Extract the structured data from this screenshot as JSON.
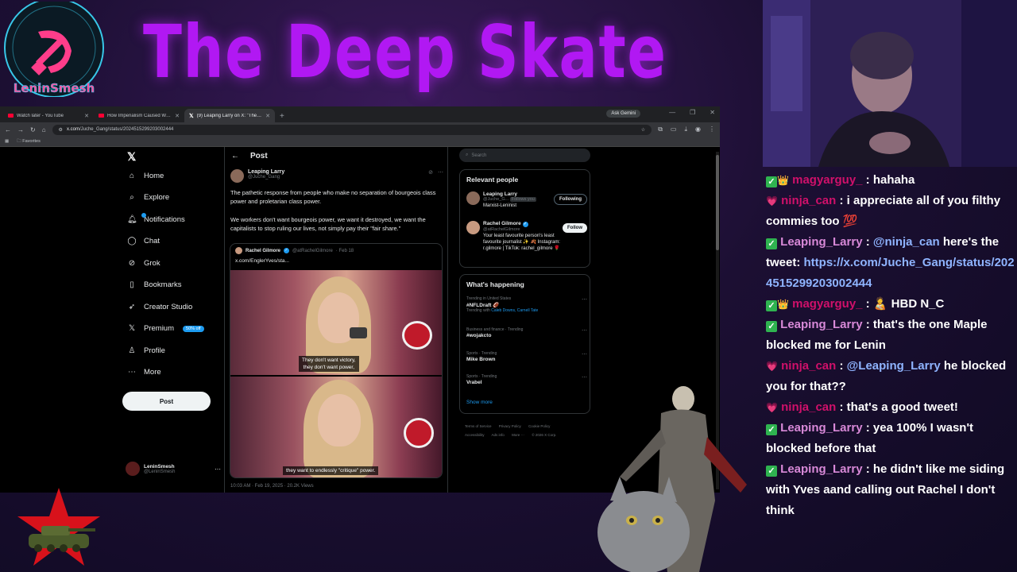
{
  "overlay": {
    "logo_text": "LeninSmesh",
    "title": "The Deep Skate"
  },
  "browser": {
    "tabs": [
      {
        "label": "Watch later - YouTube",
        "icon": "youtube-icon"
      },
      {
        "label": "How Imperialism Caused World...",
        "icon": "youtube-icon"
      },
      {
        "label": "(9) Leaping Larry on X: \"The pa...",
        "icon": "x-icon"
      }
    ],
    "ask_gemini": "Ask Gemini",
    "url_host": "x.com",
    "url_path": "/Juche_Gang/status/2024515299203002444",
    "bookmark_folder": "Favorites"
  },
  "nav": {
    "items": [
      {
        "label": "Home",
        "icon": "home-icon"
      },
      {
        "label": "Explore",
        "icon": "search-icon"
      },
      {
        "label": "Notifications",
        "icon": "bell-icon"
      },
      {
        "label": "Chat",
        "icon": "chat-icon"
      },
      {
        "label": "Grok",
        "icon": "grok-icon"
      },
      {
        "label": "Bookmarks",
        "icon": "bookmark-icon"
      },
      {
        "label": "Creator Studio",
        "icon": "rocket-icon"
      },
      {
        "label": "Premium",
        "icon": "x-icon"
      },
      {
        "label": "Profile",
        "icon": "person-icon"
      },
      {
        "label": "More",
        "icon": "more-icon"
      }
    ],
    "premium_badge": "50% off",
    "post_button": "Post",
    "account_name": "LeninSmesh",
    "account_handle": "@LeninSmesh"
  },
  "post": {
    "header": "Post",
    "author_name": "Leaping Larry",
    "author_handle": "@Juche_Gang",
    "paragraph1": "The pathetic response from people who make no separation of bourgeois class power and proletarian class power.",
    "paragraph2": "We workers don't want bourgeois power, we want it destroyed, we want the capitalists to stop ruling our lives, not simply pay their \"fair share.\"",
    "quote": {
      "author": "Rachel Gilmore",
      "handle": "@atRachelGilmore",
      "date": "· Feb 18",
      "text": "x.com/EnglerYves/sta...",
      "caption1_line1": "They don't want victory,",
      "caption1_line2": "they don't want power,",
      "caption2": "they want to endlessly \"critique\" power."
    },
    "timestamp": "10:03 AM · Feb 19, 2025 · 20.2K Views"
  },
  "right": {
    "search_placeholder": "Search",
    "relevant_title": "Relevant people",
    "people": [
      {
        "name": "Leaping Larry",
        "handle": "@Juche_G...",
        "follows_you": "Follows you",
        "bio": "Marxist-Leninist",
        "button": "Following"
      },
      {
        "name": "Rachel Gilmore",
        "handle": "@atRachelGilmore",
        "bio": "Your least favourite person's least favourite journalist ✨ 🍂 Instagram: r.gilmore | TikTok: rachel_gilmore 🌹",
        "button": "Follow"
      }
    ],
    "happening_title": "What's happening",
    "trends": [
      {
        "context": "Trending in United States",
        "title": "#NFLDraft 🏈",
        "sub_prefix": "Trending with ",
        "sub_link": "Caleb Downs, Carnell Tate"
      },
      {
        "context": "Business and finance · Trending",
        "title": "#wojakcto",
        "sub_prefix": "",
        "sub_link": ""
      },
      {
        "context": "Sports · Trending",
        "title": "Mike Brown",
        "sub_prefix": "",
        "sub_link": ""
      },
      {
        "context": "Sports · Trending",
        "title": "Vrabel",
        "sub_prefix": "",
        "sub_link": ""
      }
    ],
    "show_more": "Show more",
    "footer": [
      "Terms of Service",
      "Privacy Policy",
      "Cookie Policy",
      "Accessibility",
      "Ads info",
      "More ···",
      "© 2026 X Corp."
    ]
  },
  "chat": {
    "messages": [
      {
        "user": "magyarguy_",
        "user_color": "#d0106a",
        "badge": "👑",
        "text": ": hahaha"
      },
      {
        "user": "ninja_can",
        "user_color": "#d0106a",
        "badge": "💗",
        "text": ": i appreciate all of you filthy commies too 💯"
      },
      {
        "user": "Leaping_Larry",
        "user_color": "#d889d8",
        "badge": "",
        "text": ": ",
        "mention": "@ninja_can",
        "text2": " here's the tweet: ",
        "url": "https://x.com/Juche_Gang/status/2024515299203002444"
      },
      {
        "user": "magyarguy_",
        "user_color": "#d0106a",
        "badge": "👑",
        "text": ": 🧑‍🍼 HBD N_C"
      },
      {
        "user": "Leaping_Larry",
        "user_color": "#d889d8",
        "badge": "",
        "text": ": that's the one Maple blocked me for Lenin"
      },
      {
        "user": "ninja_can",
        "user_color": "#d0106a",
        "badge": "💗",
        "text": ": ",
        "mention": "@Leaping_Larry",
        "text2": " he blocked you for that??"
      },
      {
        "user": "ninja_can",
        "user_color": "#d0106a",
        "badge": "💗",
        "text": ": that's a good tweet!"
      },
      {
        "user": "Leaping_Larry",
        "user_color": "#d889d8",
        "badge": "",
        "text": ": yea 100% I wasn't blocked before that"
      },
      {
        "user": "Leaping_Larry",
        "user_color": "#d889d8",
        "badge": "",
        "text": ": he didn't like me siding with Yves aand calling out Rachel I don't think"
      }
    ]
  }
}
